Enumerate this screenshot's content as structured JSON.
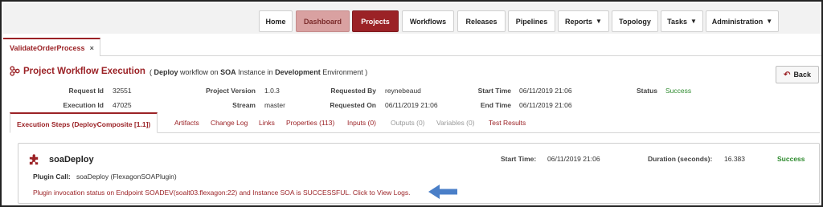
{
  "nav": {
    "items": [
      {
        "label": "Home"
      },
      {
        "label": "Dashboard"
      },
      {
        "label": "Projects"
      },
      {
        "label": "Workflows"
      },
      {
        "label": "Releases"
      },
      {
        "label": "Pipelines"
      },
      {
        "label": "Reports"
      },
      {
        "label": "Topology"
      },
      {
        "label": "Tasks"
      },
      {
        "label": "Administration"
      }
    ]
  },
  "tab": {
    "label": "ValidateOrderProcess",
    "close": "×"
  },
  "page": {
    "title": "Project Workflow Execution",
    "subtitle_open": "(",
    "subtitle_deploy": "Deploy",
    "subtitle_mid1": "workflow on",
    "subtitle_soa": "SOA",
    "subtitle_mid2": "Instance in",
    "subtitle_env": "Development",
    "subtitle_end": "Environment )",
    "back_label": "Back"
  },
  "info": {
    "request_id_label": "Request Id",
    "request_id": "32551",
    "execution_id_label": "Execution Id",
    "execution_id": "47025",
    "project_version_label": "Project Version",
    "project_version": "1.0.3",
    "stream_label": "Stream",
    "stream": "master",
    "requested_by_label": "Requested By",
    "requested_by": "reynebeaud",
    "requested_on_label": "Requested On",
    "requested_on": "06/11/2019 21:06",
    "start_time_label": "Start Time",
    "start_time": "06/11/2019 21:06",
    "end_time_label": "End Time",
    "end_time": "06/11/2019 21:06",
    "status_label": "Status",
    "status": "Success"
  },
  "exec_tabs": [
    {
      "label": "Execution Steps (DeployComposite [1.1])"
    },
    {
      "label": "Artifacts"
    },
    {
      "label": "Change Log"
    },
    {
      "label": "Links"
    },
    {
      "label": "Properties (113)"
    },
    {
      "label": "Inputs (0)"
    },
    {
      "label": "Outputs (0)"
    },
    {
      "label": "Variables (0)"
    },
    {
      "label": "Test Results"
    }
  ],
  "step": {
    "name": "soaDeploy",
    "start_label": "Start Time:",
    "start_value": "06/11/2019 21:06",
    "duration_label": "Duration (seconds):",
    "duration_value": "16.383",
    "status": "Success",
    "plugin_label": "Plugin Call:",
    "plugin_value": "soaDeploy (FlexagonSOAPlugin)",
    "message": "Plugin invocation status on Endpoint SOADEV(soalt03.flexagon:22) and Instance SOA is SUCCESSFUL. Click to View Logs."
  },
  "colors": {
    "accent": "#9b2226",
    "success": "#2d8a2d",
    "arrow": "#4a7fc8"
  }
}
